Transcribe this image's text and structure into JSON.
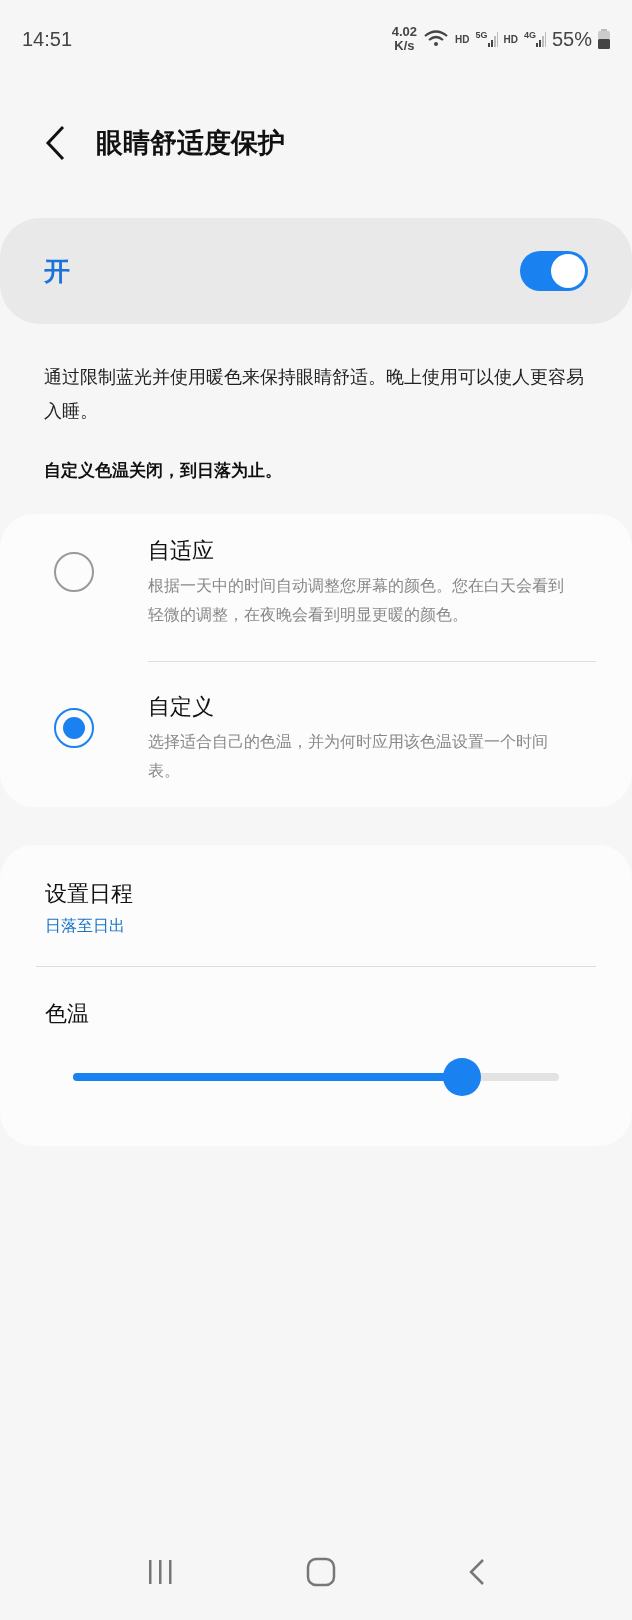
{
  "status_bar": {
    "time": "14:51",
    "speed": [
      "4.02",
      "K/s"
    ],
    "network_labels": [
      "HD",
      "5G",
      "HD",
      "4G"
    ],
    "battery": "55%"
  },
  "header": {
    "title": "眼睛舒适度保护"
  },
  "master_switch": {
    "label": "开",
    "on": true
  },
  "description": "通过限制蓝光并使用暖色来保持眼睛舒适。晚上使用可以使人更容易入睡。",
  "status_note": "自定义色温关闭，到日落为止。",
  "modes": [
    {
      "title": "自适应",
      "subtitle": "根据一天中的时间自动调整您屏幕的颜色。您在白天会看到轻微的调整，在夜晚会看到明显更暖的颜色。",
      "selected": false
    },
    {
      "title": "自定义",
      "subtitle": "选择适合自己的色温，并为何时应用该色温设置一个时间表。",
      "selected": true
    }
  ],
  "schedule": {
    "title": "设置日程",
    "value": "日落至日出"
  },
  "color_temperature": {
    "title": "色温",
    "level": 0.8
  }
}
